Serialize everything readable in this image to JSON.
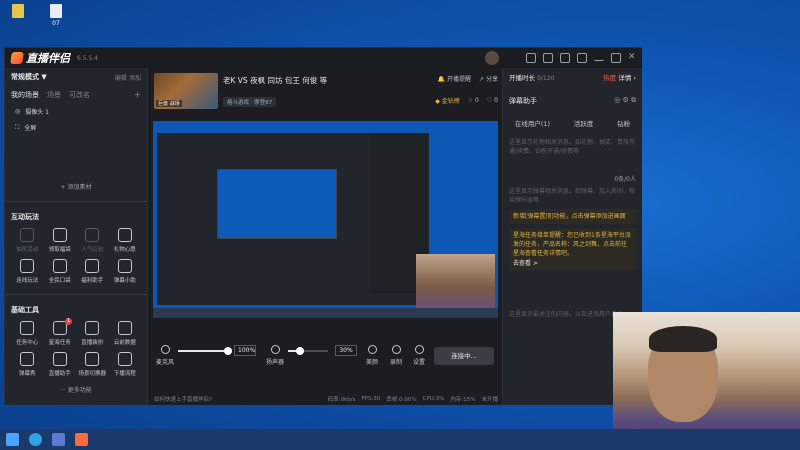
{
  "desktop": {
    "icons": [
      "",
      "07"
    ]
  },
  "app": {
    "name": "直播伴侣",
    "version": "6.5.5.4"
  },
  "left": {
    "mode_label": "常规模式 ▼",
    "edit_label": "编辑",
    "add_label": "添加",
    "scenes_tabs": [
      "我的场景",
      "场景",
      "可改名"
    ],
    "sources": [
      "摄像头 1",
      "全屏"
    ],
    "add_material": "+ 添加素材",
    "interactive_title": "互动玩法",
    "interactive": [
      "抽奖活动",
      "领取福袋",
      "人气红包",
      "礼物心愿",
      "连线玩法",
      "全民口袋",
      "福利助手",
      "弹幕小助"
    ],
    "tools_title": "基础工具",
    "tools": [
      "任务中心",
      "星海任务",
      "直播装扮",
      "云前数据",
      "弹幕秀",
      "直播助手",
      "场景切换器",
      "下播流程"
    ],
    "tools_badge": "1",
    "more": "··· 更多功能"
  },
  "center": {
    "room_title": "老K VS 夜枫 同坊 包王 何俊 等",
    "thumb_text": "巨兽 战场",
    "category": "格斗游戏 · 摩登87",
    "head_actions": [
      "开播提醒",
      "分享"
    ],
    "gold": "金钻榜",
    "likes": "0",
    "favs": "0",
    "mic_label": "麦克风",
    "mic_pct": "100%",
    "speaker_label": "扬声器",
    "speaker_pct": "30%",
    "effect_labels": [
      "美颜",
      "录制",
      "设置"
    ],
    "connect_label": "连接中...",
    "status": [
      "如何快速上手直播伴侣?",
      "码率:0kb/s",
      "FPS:30",
      "丢帧:0.00%",
      "CPU:3%",
      "内存:15%",
      "未开播"
    ]
  },
  "right": {
    "live_time_label": "开播时长",
    "live_time": "0/120",
    "hot_label": "热度",
    "detail": "详情 ›",
    "dm_title": "弹幕助手",
    "tabs": [
      "在线用户(1)",
      "活跃度",
      "钻粉"
    ],
    "dm_hint": "这里显示礼物相关消息，如礼物、抽奖、贵族开通/续费、钻粉开通/续费等",
    "dm_count": "0条/0人",
    "dm_hint2": "这里显示弹幕相关消息，如弹幕、加入房间、粉丝牌升级等",
    "notice1": "新增[弹幕置顶]功能，点击弹幕添加进画面",
    "notice2": "星海任务接单提醒：您已收到1条星海平台派发的任务，产品名称：风之剑舞，点击前往星海查看任务详情吧。",
    "notice2_link": "去查看 >",
    "footer_hint": "这里显示最关注的内容，以及进场用户自动"
  },
  "colors": {
    "accent": "#ff5a3c",
    "gold": "#e8b44a",
    "desktop": "#1568c8"
  }
}
